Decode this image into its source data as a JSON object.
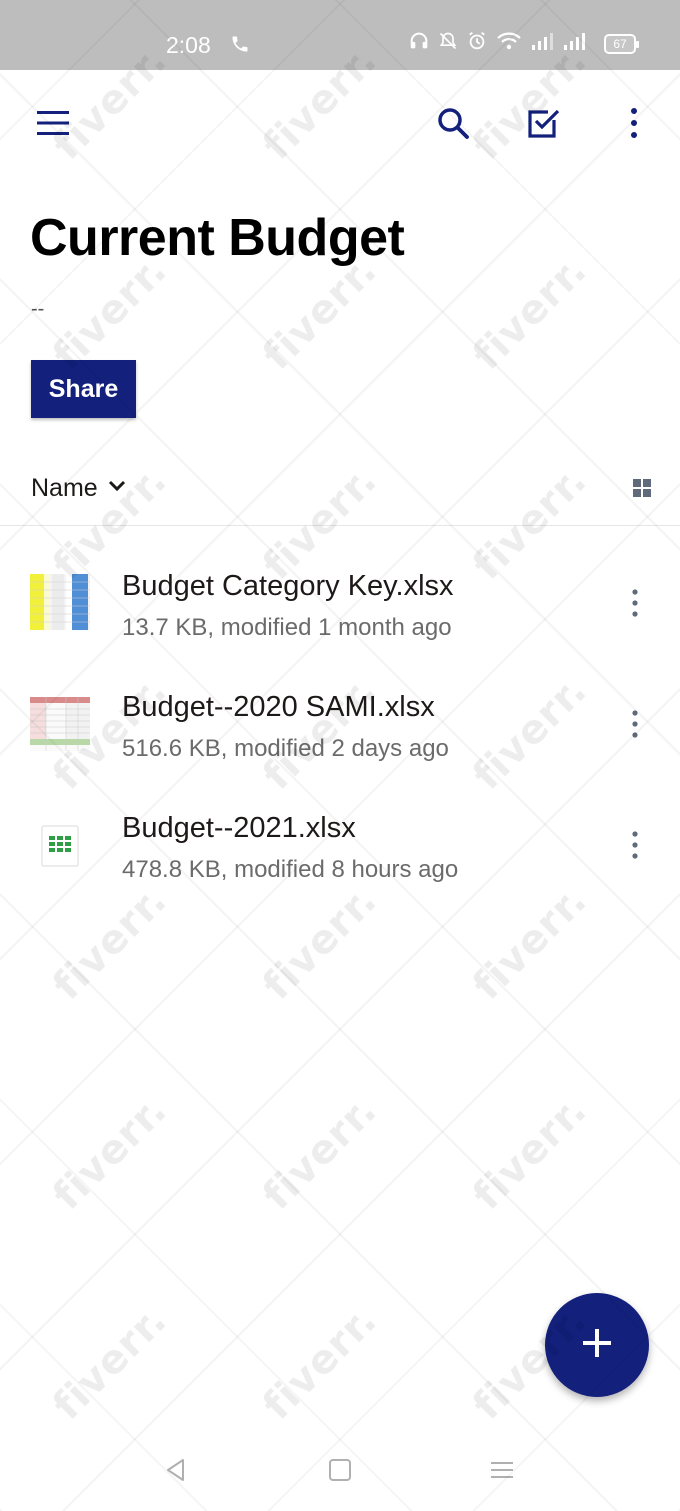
{
  "status_bar": {
    "time": "2:08",
    "battery": "67",
    "icons": [
      "phone-icon",
      "headphones-icon",
      "mute-icon",
      "alarm-icon",
      "wifi-icon",
      "signal-icon",
      "signal-icon",
      "battery-icon"
    ]
  },
  "toolbar": {
    "icons": [
      "menu-icon",
      "search-icon",
      "checkbox-select-icon",
      "more-vert-icon"
    ],
    "accent_color": "#13207c"
  },
  "folder": {
    "title": "Current Budget",
    "subtitle": "--",
    "share_label": "Share"
  },
  "sort": {
    "label": "Name",
    "icons": [
      "chevron-down-icon",
      "grid-view-icon"
    ]
  },
  "files": [
    {
      "name": "Budget Category Key.xlsx",
      "meta": "13.7 KB, modified 1 month ago",
      "thumbnail": "spreadsheet-preview-yellow-blue"
    },
    {
      "name": "Budget--2020 SAMI.xlsx",
      "meta": "516.6 KB, modified 2 days ago",
      "thumbnail": "spreadsheet-preview-pink-table"
    },
    {
      "name": "Budget--2021.xlsx",
      "meta": "478.8 KB, modified 8 hours ago",
      "thumbnail": "spreadsheet-file-icon-green"
    }
  ],
  "fab": {
    "icon": "plus-icon"
  },
  "nav_bar": {
    "icons": [
      "back-triangle-icon",
      "home-square-icon",
      "recents-menu-icon"
    ]
  },
  "watermark": {
    "text": "fiverr."
  }
}
